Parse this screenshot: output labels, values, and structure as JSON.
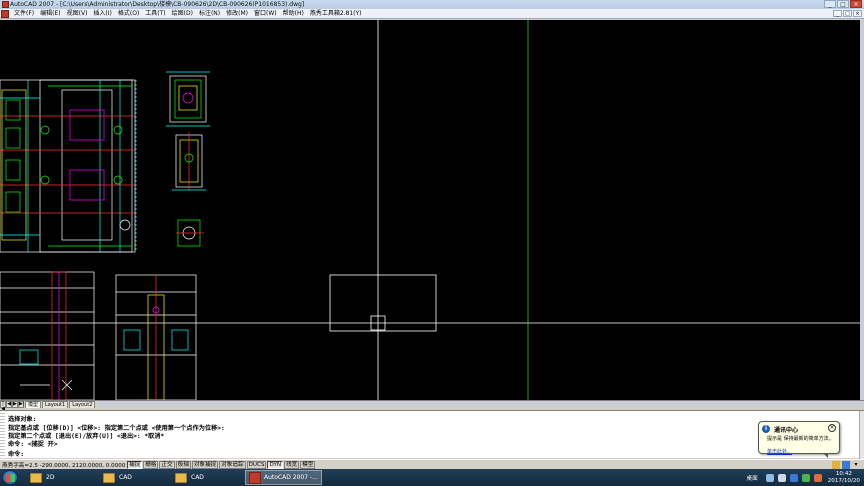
{
  "window": {
    "title": "AutoCAD 2007 - [C:\\Users\\Administrator\\Desktop\\楼模\\CB-090626\\2D\\CB-090626(P1016853).dwg]",
    "buttons": [
      "_",
      "□",
      "×"
    ]
  },
  "menu": {
    "items": [
      "文件(F)",
      "编辑(E)",
      "视图(V)",
      "插入(I)",
      "格式(O)",
      "工具(T)",
      "绘图(D)",
      "标注(N)",
      "修改(M)",
      "窗口(W)",
      "帮助(H)",
      "燕秀工具箱2.81(Y)"
    ],
    "doc_buttons": [
      "_",
      "□",
      "×"
    ]
  },
  "layout_tabs": {
    "nav": [
      "|◀",
      "◀",
      "▶",
      "▶|"
    ],
    "tabs": [
      "模型",
      "Layout1",
      "Layout2"
    ],
    "active": "模型"
  },
  "command": {
    "lines": [
      "选择对象:",
      "指定基点或 [位移(D)] <位移>:  指定第二个点或 <使用第一个点作为位移>:",
      "指定第二个点或 [退出(E)/放弃(U)] <退出>:  *取消*",
      "命令:  <捕捉 开>",
      "命令:"
    ]
  },
  "status": {
    "coords": "燕秀字高=2.5  -290.0000,  2120.0000,  0.0000",
    "toggles": [
      {
        "label": "捕捉",
        "on": true
      },
      {
        "label": "栅格",
        "on": false
      },
      {
        "label": "正交",
        "on": false
      },
      {
        "label": "极轴",
        "on": false
      },
      {
        "label": "对象捕捉",
        "on": false
      },
      {
        "label": "对象追踪",
        "on": false
      },
      {
        "label": "DUCS",
        "on": false
      },
      {
        "label": "DYN",
        "on": true
      },
      {
        "label": "线宽",
        "on": false
      },
      {
        "label": "模型",
        "on": false
      }
    ]
  },
  "balloon": {
    "title": "通讯中心",
    "line1": "提示是 保持最新的简单方法。",
    "line2": "单击此处。"
  },
  "taskbar": {
    "items": [
      {
        "label": "2D",
        "type": "folder"
      },
      {
        "label": "CAD",
        "type": "folder"
      },
      {
        "label": "CAD",
        "type": "folder"
      },
      {
        "label": "AutoCAD 2007 -...",
        "type": "app"
      }
    ],
    "tray_label": "桌面",
    "time": "10:42",
    "date": "2017/10/20"
  },
  "colors": {
    "canvas_bg": "#000000",
    "crosshair": "#ffffff",
    "green_line": "#2ecc40"
  }
}
